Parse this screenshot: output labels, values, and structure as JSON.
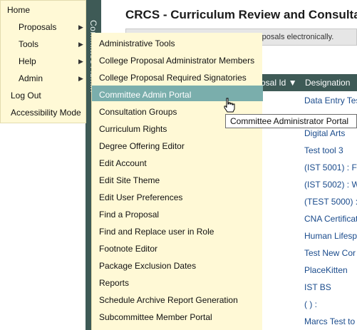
{
  "app": {
    "title": "CRCS - Curriculum Review and Consultatio",
    "notice": "This tool is designed for reviewing proposals electronically.",
    "side_tab": "Committee Admin"
  },
  "main_menu": {
    "items": [
      {
        "label": "Home",
        "has_submenu": false
      },
      {
        "label": "Proposals",
        "has_submenu": true
      },
      {
        "label": "Tools",
        "has_submenu": true
      },
      {
        "label": "Help",
        "has_submenu": true
      },
      {
        "label": "Admin",
        "has_submenu": true
      },
      {
        "label": "Log Out",
        "has_submenu": false
      },
      {
        "label": "Accessibility Mode",
        "has_submenu": false
      }
    ]
  },
  "admin_submenu": {
    "items": [
      "Administrative Tools",
      "College Proposal Administrator Members",
      "College Proposal Required Signatories",
      "Committee Admin Portal",
      "Consultation Groups",
      "Curriculum Rights",
      "Degree Offering Editor",
      "Edit Account",
      "Edit Site Theme",
      "Edit User Preferences",
      "Find a Proposal",
      "Find and Replace user in Role",
      "Footnote Editor",
      "Package Exclusion Dates",
      "Reports",
      "Schedule Archive Report Generation",
      "Subcommittee Member Portal"
    ],
    "highlighted_index": 3
  },
  "tooltip": "Committee Administrator Portal",
  "table": {
    "columns": [
      "osal Id ▼",
      "Designation"
    ],
    "designations": [
      "Data Entry Tes",
      "Digital Arts",
      "Test tool 3",
      "(IST 5001) : F",
      "(IST 5002) : W",
      "(TEST 5000) :",
      "CNA Certificat",
      "Human Lifesp",
      "Test New Cor",
      "PlaceKitten",
      "IST BS",
      "( ) :",
      "Marcs Test to"
    ]
  },
  "colors": {
    "menu_bg": "#fff9d6",
    "highlight": "#7aaeac",
    "header": "#3e5a56",
    "link": "#1a4b8c"
  }
}
